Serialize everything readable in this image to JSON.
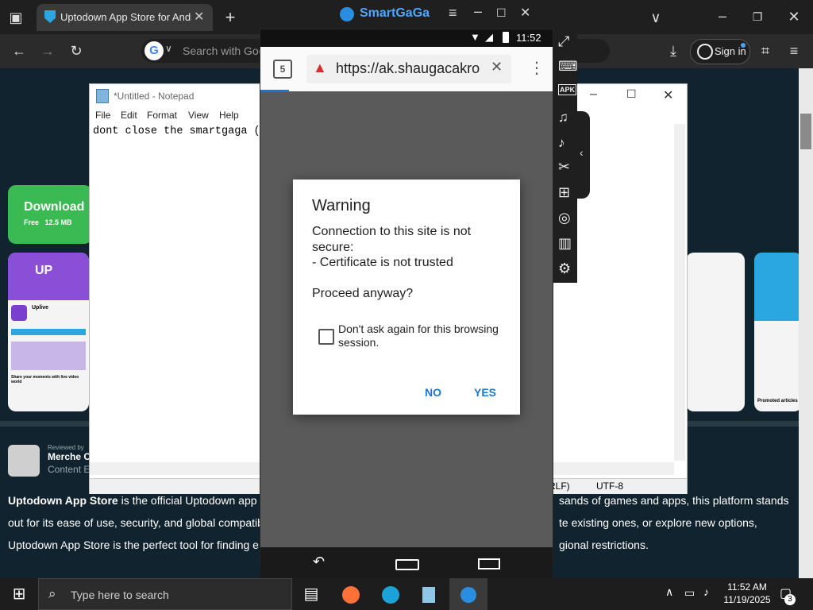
{
  "browser": {
    "tab_title": "Uptodown App Store for Andro",
    "search_placeholder": "Search with Goo",
    "signin_label": "Sign in"
  },
  "uptodown": {
    "download_label": "Download",
    "download_meta": "Free   12.5 MB",
    "app_name": "Uplive",
    "app_tagline": "Share your moments with live video world",
    "reviewed_by": "Reviewed by",
    "reviewer_name": "Merche C",
    "reviewer_role": "Content E",
    "promoted": "Promoted articles",
    "desc_bold": "Uptodown App Store",
    "desc_line1a": " is the official Uptodown app",
    "desc_line1b": "sands of games and apps, this platform stands",
    "desc_line2a": "out for its ease of use, security, and global compatib",
    "desc_line2b": "te existing ones, or explore new options,",
    "desc_line3a": "Uptodown App Store is the perfect tool for finding e",
    "desc_line3b": "gional restrictions."
  },
  "notepad": {
    "title": "*Untitled - Notepad",
    "menu": [
      "File",
      "Edit",
      "Format",
      "View",
      "Help"
    ],
    "content": "dont close the smartgaga (b",
    "status_eol": "RLF)",
    "status_encoding": "UTF-8"
  },
  "emulator": {
    "app_title": "SmartGaGa",
    "time": "11:52",
    "tab_count": "5",
    "url": "https://ak.shaugacakro"
  },
  "dialog": {
    "title": "Warning",
    "message": "Connection to this site is not secure:\n - Certificate is not trusted\n\nProceed anyway?",
    "checkbox_label": "Don't ask again for this browsing session.",
    "checkbox_checked": false,
    "no_label": "NO",
    "yes_label": "YES"
  },
  "taskbar": {
    "search_placeholder": "Type here to search",
    "time": "11:52 AM",
    "date": "11/19/2025",
    "notification_count": "3"
  },
  "colors": {
    "accent_blue": "#1976d2",
    "download_green": "#3bba54",
    "page_bg": "#10232e"
  }
}
